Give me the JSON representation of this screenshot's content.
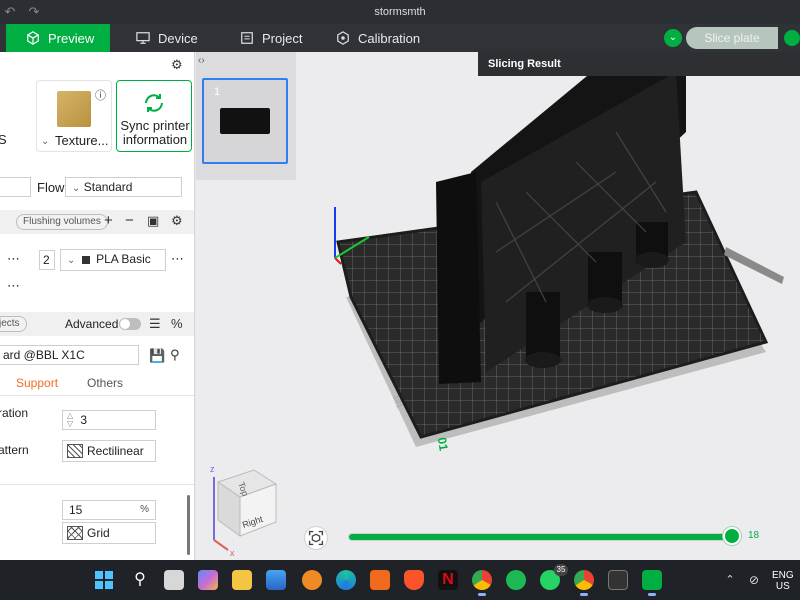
{
  "window": {
    "title": "stormsmth"
  },
  "nav": {
    "tabs": [
      {
        "label": "Preview",
        "icon": "cube-icon",
        "active": true
      },
      {
        "label": "Device",
        "icon": "monitor-icon",
        "active": false
      },
      {
        "label": "Project",
        "icon": "document-icon",
        "active": false
      },
      {
        "label": "Calibration",
        "icon": "calibration-icon",
        "active": false
      }
    ],
    "slice_label": "Slice plate"
  },
  "sidebar": {
    "plate_cards": {
      "left_char": "S",
      "texture_label": "Texture...",
      "sync_label": "Sync printer information"
    },
    "flow_label": "Flow",
    "flow_value": "Standard",
    "flushing_label": "Flushing volumes",
    "filament": {
      "slot": "2",
      "name": "PLA Basic"
    },
    "objects_tag": "jects",
    "advanced_label": "Advanced",
    "profile_value": "ard @BBL X1C",
    "tabs": [
      {
        "label": "Support",
        "active": true
      },
      {
        "label": "Others",
        "active": false
      }
    ],
    "settings": [
      {
        "label": "ration",
        "value": "3"
      },
      {
        "label": "attern",
        "value": "Rectilinear"
      }
    ],
    "settings2": [
      {
        "value": "15",
        "unit": "%"
      },
      {
        "value": "Grid"
      }
    ]
  },
  "viewport": {
    "plate_thumb_number": "1",
    "result_title": "Slicing Result",
    "layer_slider": {
      "value": "18",
      "fraction": 0.99
    },
    "bed_label": "01",
    "bed_side_label": "101",
    "cube_labels": {
      "front": "Right",
      "top": "Top"
    },
    "axis_z": "z",
    "axis_x": "x"
  },
  "taskbar": {
    "language": "ENG",
    "region": "US",
    "whatsapp_badge": "35"
  },
  "colors": {
    "accent": "#00ae42",
    "highlight": "#f36c21"
  }
}
